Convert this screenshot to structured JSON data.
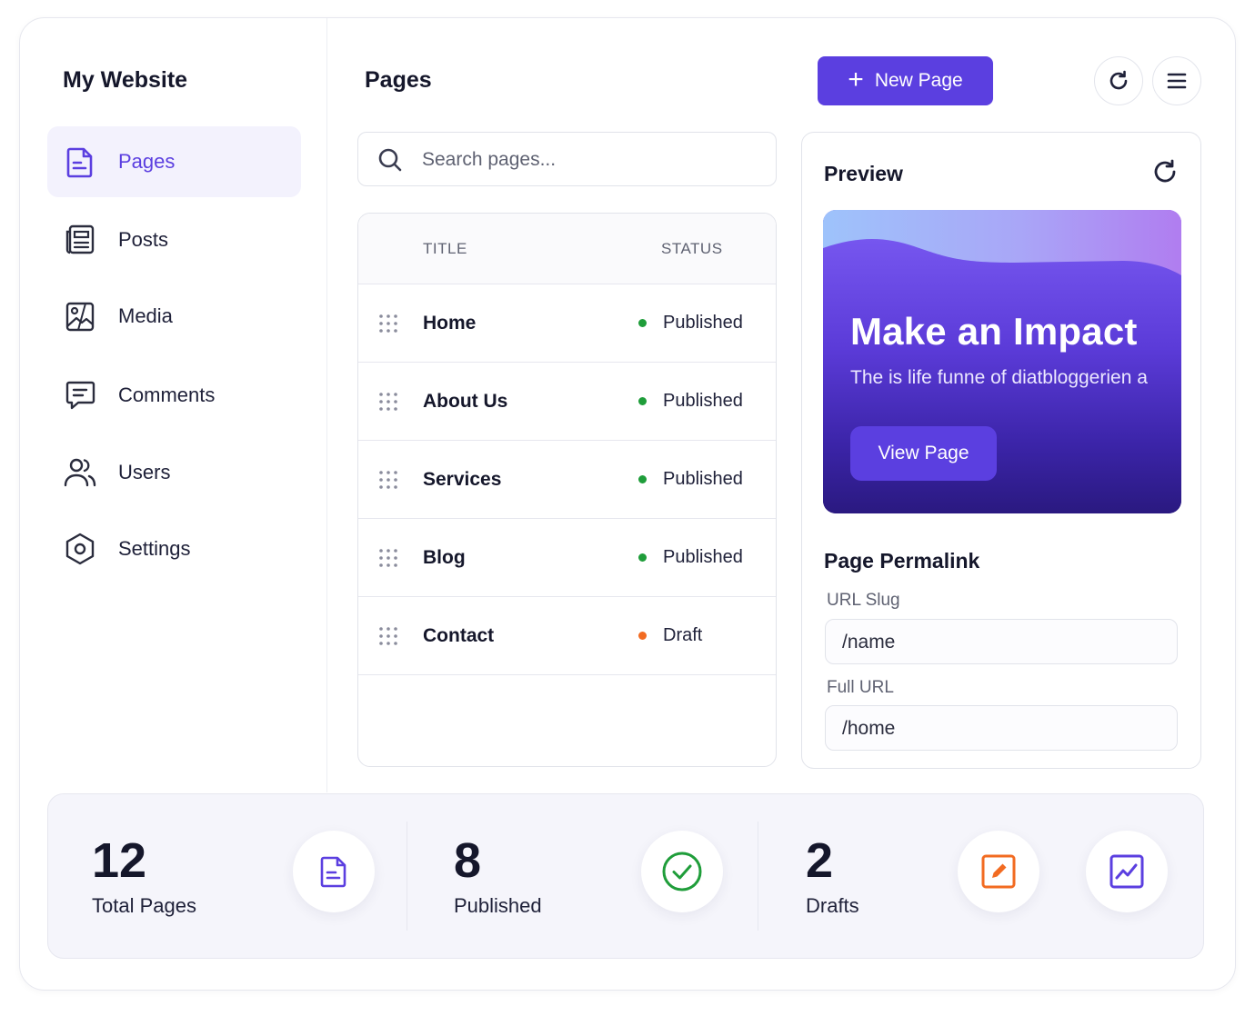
{
  "sidebar": {
    "brand": "My Website",
    "items": [
      {
        "label": "Pages",
        "icon": "file-text-icon",
        "active": true
      },
      {
        "label": "Posts",
        "icon": "newspaper-icon",
        "active": false
      },
      {
        "label": "Media",
        "icon": "image-icon",
        "active": false
      },
      {
        "label": "Comments",
        "icon": "comment-icon",
        "active": false
      },
      {
        "label": "Users",
        "icon": "users-icon",
        "active": false
      },
      {
        "label": "Settings",
        "icon": "settings-hex-icon",
        "active": false
      }
    ]
  },
  "header": {
    "title": "Pages",
    "new_page_label": "New Page",
    "accent": "#5b3fe0"
  },
  "search": {
    "placeholder": "Search pages..."
  },
  "table": {
    "headers": {
      "title": "TITLE",
      "status": "STATUS"
    },
    "rows": [
      {
        "title": "Home",
        "status": "Published",
        "status_color": "#1f9d3a"
      },
      {
        "title": "About Us",
        "status": "Published",
        "status_color": "#1f9d3a"
      },
      {
        "title": "Services",
        "status": "Published",
        "status_color": "#1f9d3a"
      },
      {
        "title": "Blog",
        "status": "Published",
        "status_color": "#1f9d3a"
      },
      {
        "title": "Contact",
        "status": "Draft",
        "status_color": "#f26b21"
      }
    ]
  },
  "preview": {
    "title": "Preview",
    "hero_heading": "Make an Impact",
    "hero_subtitle": "The is life funne of diatbloggerien a",
    "hero_button": "View Page",
    "permalink_title": "Page Permalink",
    "url_slug_label": "URL Slug",
    "url_slug_value": "/name",
    "full_url_label": "Full URL",
    "full_url_value": "/home"
  },
  "stats": [
    {
      "value": "12",
      "label": "Total Pages",
      "icon": "file-text-icon"
    },
    {
      "value": "8",
      "label": "Published",
      "icon": "check-circle-icon"
    },
    {
      "value": "2",
      "label": "Drafts",
      "icon": "edit-icon"
    }
  ],
  "stats_extra_icon": "analytics-chart-icon"
}
